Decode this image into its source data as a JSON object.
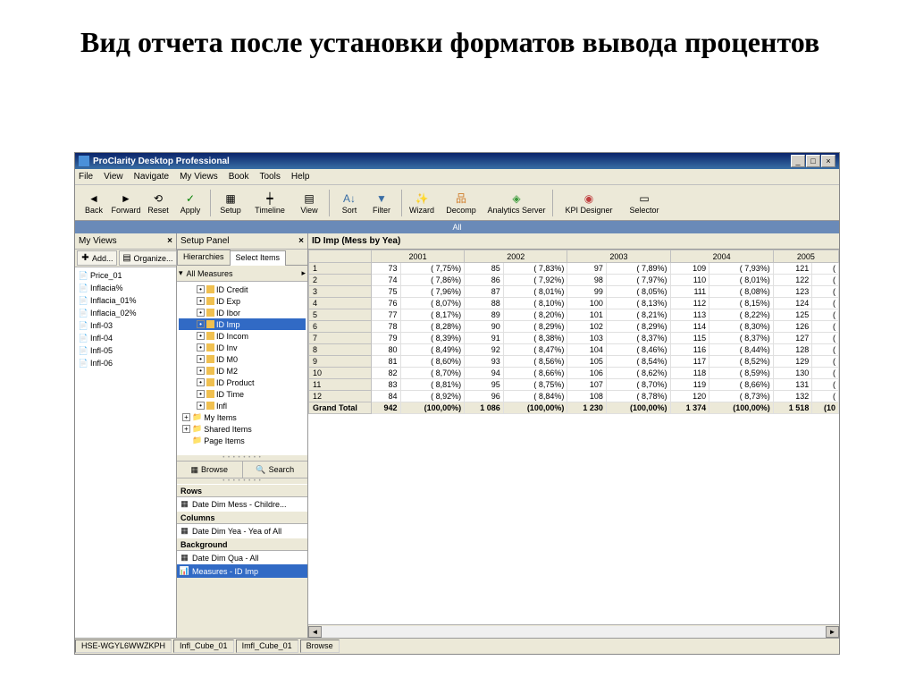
{
  "slide_title": "Вид отчета после установки форматов вывода процентов",
  "app_title": "ProClarity Desktop Professional",
  "menu": [
    "File",
    "View",
    "Navigate",
    "My Views",
    "Book",
    "Tools",
    "Help"
  ],
  "toolbar": {
    "back": "Back",
    "forward": "Forward",
    "reset": "Reset",
    "apply": "Apply",
    "setup": "Setup",
    "timeline": "Timeline",
    "view": "View",
    "sort": "Sort",
    "filter": "Filter",
    "wizard": "Wizard",
    "decomp": "Decomp",
    "aserver": "Analytics Server",
    "kpi": "KPI Designer",
    "selector": "Selector"
  },
  "all_bar": "All",
  "myviews": {
    "title": "My Views",
    "add": "Add...",
    "organize": "Organize...",
    "items": [
      "Price_01",
      "Inflacia%",
      "Inflacia_01%",
      "Inflacia_02%",
      "Infl-03",
      "Infl-04",
      "Infl-05",
      "Infl-06"
    ]
  },
  "setup": {
    "title": "Setup Panel",
    "tabs": {
      "hier": "Hierarchies",
      "sel": "Select Items"
    },
    "all_measures": "All Measures",
    "measures": [
      "ID Credit",
      "ID Exp",
      "ID Ibor",
      "ID Imp",
      "ID Incom",
      "ID Inv",
      "ID M0",
      "ID M2",
      "ID Product",
      "ID Time",
      "Infl"
    ],
    "my_items": "My Items",
    "shared_items": "Shared Items",
    "page_items": "Page Items",
    "browse": "Browse",
    "search": "Search",
    "rows_title": "Rows",
    "rows_item": "Date Dim Mess - Childre...",
    "cols_title": "Columns",
    "cols_item": "Date Dim Yea - Yea of All",
    "bg_title": "Background",
    "bg_item1": "Date Dim Qua - All",
    "bg_item2": "Measures - ID Imp"
  },
  "chart_data": {
    "type": "table",
    "title": "ID Imp (Mess by Yea)",
    "columns": [
      "2001",
      "2002",
      "2003",
      "2004",
      "2005"
    ],
    "rows": [
      "1",
      "2",
      "3",
      "4",
      "5",
      "6",
      "7",
      "8",
      "9",
      "10",
      "11",
      "12",
      "Grand Total"
    ],
    "cells": [
      [
        "73",
        "( 7,75%)",
        "85",
        "( 7,83%)",
        "97",
        "( 7,89%)",
        "109",
        "( 7,93%)",
        "121",
        "("
      ],
      [
        "74",
        "( 7,86%)",
        "86",
        "( 7,92%)",
        "98",
        "( 7,97%)",
        "110",
        "( 8,01%)",
        "122",
        "("
      ],
      [
        "75",
        "( 7,96%)",
        "87",
        "( 8,01%)",
        "99",
        "( 8,05%)",
        "111",
        "( 8,08%)",
        "123",
        "("
      ],
      [
        "76",
        "( 8,07%)",
        "88",
        "( 8,10%)",
        "100",
        "( 8,13%)",
        "112",
        "( 8,15%)",
        "124",
        "("
      ],
      [
        "77",
        "( 8,17%)",
        "89",
        "( 8,20%)",
        "101",
        "( 8,21%)",
        "113",
        "( 8,22%)",
        "125",
        "("
      ],
      [
        "78",
        "( 8,28%)",
        "90",
        "( 8,29%)",
        "102",
        "( 8,29%)",
        "114",
        "( 8,30%)",
        "126",
        "("
      ],
      [
        "79",
        "( 8,39%)",
        "91",
        "( 8,38%)",
        "103",
        "( 8,37%)",
        "115",
        "( 8,37%)",
        "127",
        "("
      ],
      [
        "80",
        "( 8,49%)",
        "92",
        "( 8,47%)",
        "104",
        "( 8,46%)",
        "116",
        "( 8,44%)",
        "128",
        "("
      ],
      [
        "81",
        "( 8,60%)",
        "93",
        "( 8,56%)",
        "105",
        "( 8,54%)",
        "117",
        "( 8,52%)",
        "129",
        "("
      ],
      [
        "82",
        "( 8,70%)",
        "94",
        "( 8,66%)",
        "106",
        "( 8,62%)",
        "118",
        "( 8,59%)",
        "130",
        "("
      ],
      [
        "83",
        "( 8,81%)",
        "95",
        "( 8,75%)",
        "107",
        "( 8,70%)",
        "119",
        "( 8,66%)",
        "131",
        "("
      ],
      [
        "84",
        "( 8,92%)",
        "96",
        "( 8,84%)",
        "108",
        "( 8,78%)",
        "120",
        "( 8,73%)",
        "132",
        "("
      ],
      [
        "942",
        "(100,00%)",
        "1 086",
        "(100,00%)",
        "1 230",
        "(100,00%)",
        "1 374",
        "(100,00%)",
        "1 518",
        "(10"
      ]
    ]
  },
  "status": {
    "server": "HSE-WGYL6WWZKPH",
    "cube1": "Infl_Cube_01",
    "cube2": "Imfl_Cube_01",
    "mode": "Browse"
  }
}
